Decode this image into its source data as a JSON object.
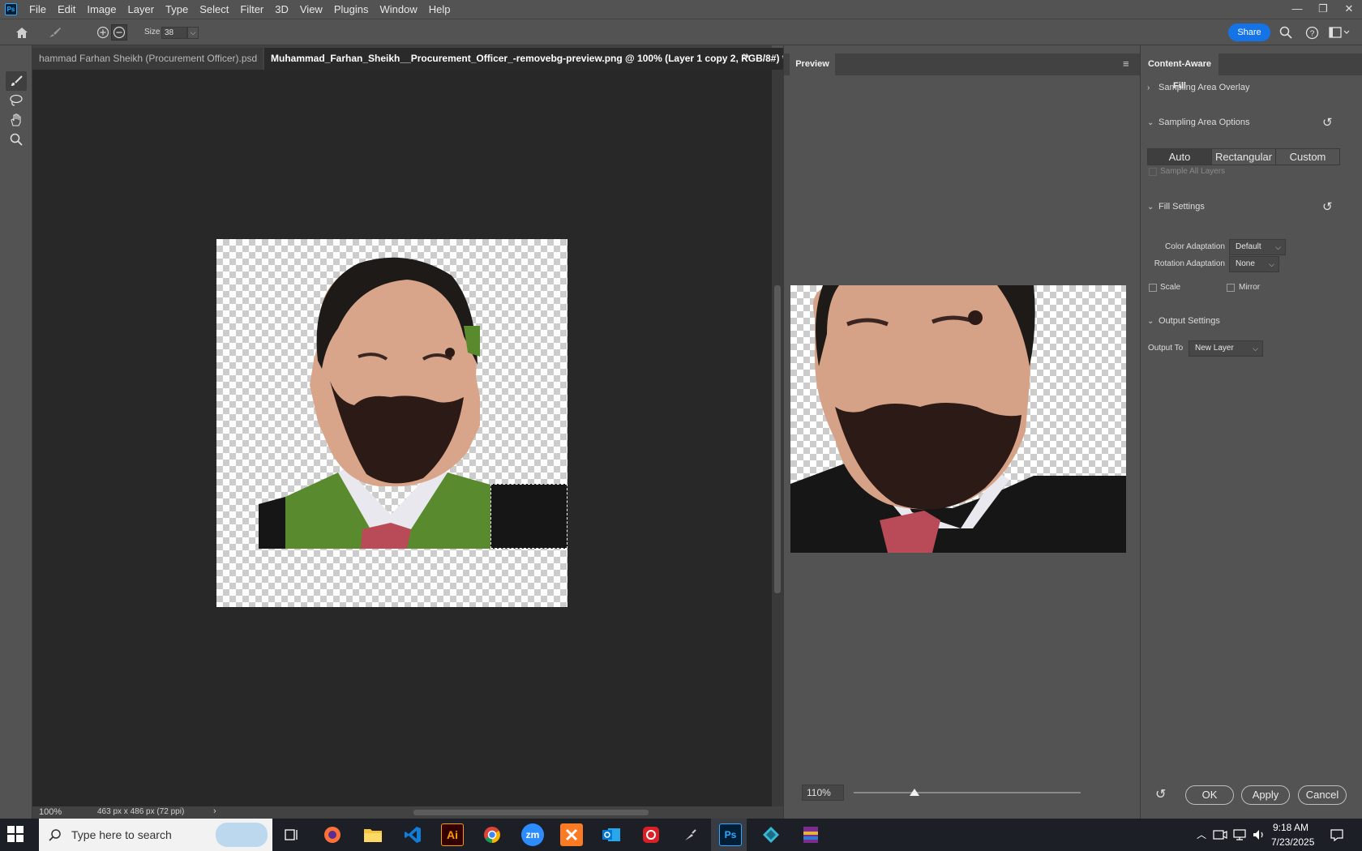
{
  "app": {
    "logo_text": "Ps",
    "menu": [
      "File",
      "Edit",
      "Image",
      "Layer",
      "Type",
      "Select",
      "Filter",
      "3D",
      "View",
      "Plugins",
      "Window",
      "Help"
    ],
    "window_controls": [
      "—",
      "❐",
      "✕"
    ]
  },
  "options": {
    "size_label": "Size",
    "size_value": "38",
    "share_label": "Share"
  },
  "document": {
    "tabs": [
      {
        "label": "hammad Farhan Sheikh (Procurement Officer).psd",
        "close": "×"
      },
      {
        "label": "Muhammad_Farhan_Sheikh__Procurement_Officer_-removebg-preview.png @ 100% (Layer 1 copy 2, RGB/8#) *",
        "close": "×"
      }
    ],
    "tab_overflow": "»",
    "status_zoom": "100%",
    "status_info": "463 px x 486 px (72 ppi)",
    "status_arrow": "›"
  },
  "preview": {
    "tab_label": "Preview",
    "zoom": "110%"
  },
  "caf": {
    "tab_label": "Content-Aware Fill",
    "sampling_overlay": "Sampling Area Overlay",
    "sampling_options": "Sampling Area Options",
    "segments": [
      "Auto",
      "Rectangular",
      "Custom"
    ],
    "sample_all_layers": "Sample All Layers",
    "fill_settings": "Fill Settings",
    "color_adaptation_label": "Color Adaptation",
    "color_adaptation_value": "Default",
    "rotation_adaptation_label": "Rotation Adaptation",
    "rotation_adaptation_value": "None",
    "scale_label": "Scale",
    "mirror_label": "Mirror",
    "output_settings": "Output Settings",
    "output_to_label": "Output To",
    "output_to_value": "New Layer",
    "ok": "OK",
    "apply": "Apply",
    "cancel": "Cancel"
  },
  "taskbar": {
    "search_placeholder": "Type here to search",
    "apps": [
      "Ai",
      "zm",
      "Ps"
    ],
    "time": "9:18 AM",
    "date": "7/23/2025"
  },
  "colors": {
    "accent": "#1473e6",
    "green_mask": "#5a8a2e",
    "jacket": "#161616"
  }
}
